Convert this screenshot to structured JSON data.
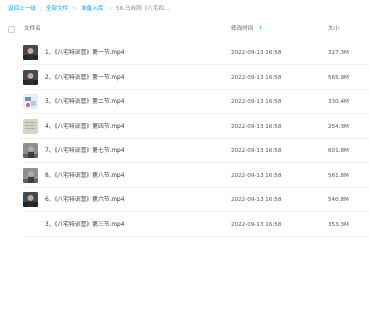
{
  "breadcrumb": {
    "back": "返回上一级",
    "all_files": "全部文件",
    "folder1": "准备入库",
    "current": "56.马自刚《八宅四..."
  },
  "columns": {
    "name": "文件名",
    "modified": "修改时间",
    "size": "大小"
  },
  "files": [
    {
      "name": "1、《八宅特训营》第一节.mp4",
      "time": "2022-09-13 16:58",
      "size": "327.3M",
      "thumb": "person-dark"
    },
    {
      "name": "2、《八宅特训营》第一节.mp4",
      "time": "2022-09-13 16:58",
      "size": "565.9M",
      "thumb": "person-dark"
    },
    {
      "name": "3、《八宅特训营》第二节.mp4",
      "time": "2022-09-13 16:58",
      "size": "330.4M",
      "thumb": "diagram-blue"
    },
    {
      "name": "4、《八宅特训营》第四节.mp4",
      "time": "2022-09-13 16:58",
      "size": "254.3M",
      "thumb": "paper-light"
    },
    {
      "name": "7、《八宅特训营》第七节.mp4",
      "time": "2022-09-13 16:58",
      "size": "601.8M",
      "thumb": "person-grey"
    },
    {
      "name": "8、《八宅特训营》第八节.mp4",
      "time": "2022-09-13 16:58",
      "size": "561.8M",
      "thumb": "person-grey"
    },
    {
      "name": "6、《八宅特训营》第六节.mp4",
      "time": "2022-09-13 16:58",
      "size": "540.8M",
      "thumb": "person-dark"
    },
    {
      "name": "3、《八宅特训营》第三节.mp4",
      "time": "2022-09-13 16:58",
      "size": "353.3M",
      "thumb": "none"
    }
  ],
  "colors": {
    "accent": "#06a7ff"
  },
  "icons": {
    "sort": "arrow-up-icon"
  }
}
